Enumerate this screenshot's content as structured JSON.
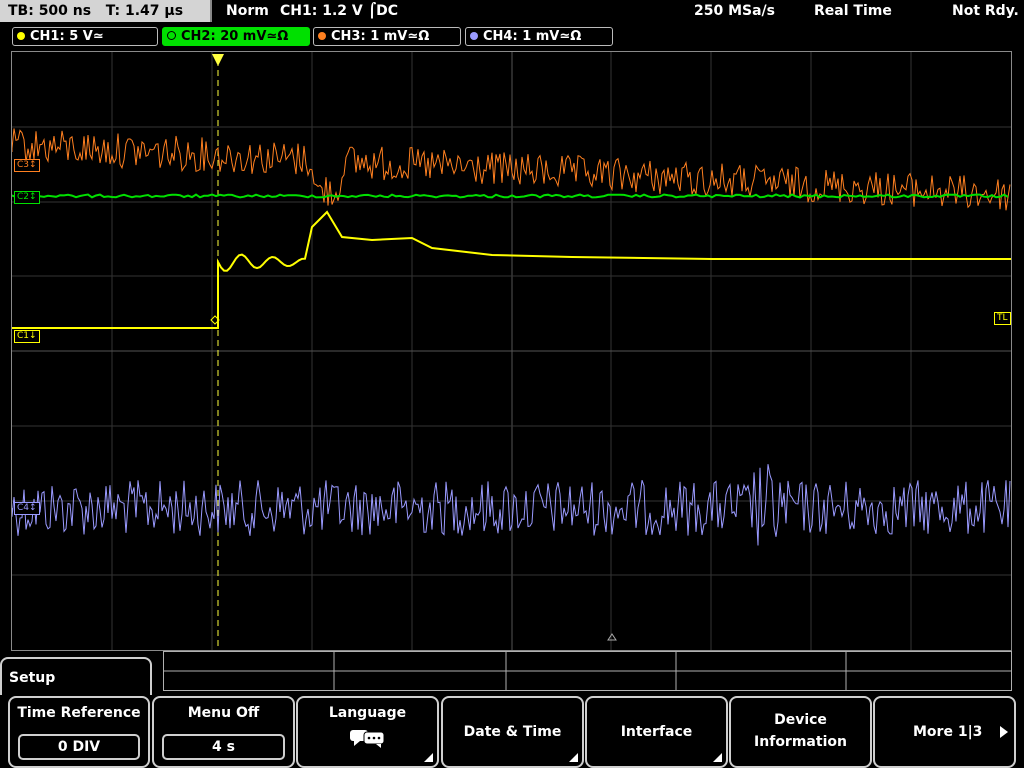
{
  "status": {
    "timebase": "TB: 500 ns",
    "trigger_time": "T: 1.47 µs",
    "mode": "Norm",
    "trigger_setting": "CH1: 1.2 V ⌠DC",
    "sample_rate": "250 MSa/s",
    "acq_mode": "Real Time",
    "readiness": "Not Rdy."
  },
  "channels": [
    {
      "label": "CH1: 5 V≃",
      "color": "#ffff00"
    },
    {
      "label": "CH2: 20 mV≃Ω",
      "color": "#00e000"
    },
    {
      "label": "CH3: 1 mV≃Ω",
      "color": "#ff8020"
    },
    {
      "label": "CH4: 1 mV≃Ω",
      "color": "#9a9aff"
    }
  ],
  "markers": {
    "ch1": "C1↓",
    "ch2": "C2↕",
    "ch3": "C3↕",
    "ch4": "C4↕",
    "trigger_level": "TL",
    "trigger_pos": "T"
  },
  "menu": {
    "title": "Setup",
    "softkeys": [
      {
        "label": "Time Reference",
        "value": "0 DIV"
      },
      {
        "label": "Menu Off",
        "value": "4 s"
      },
      {
        "label": "Language",
        "icon": "speech-bubbles-icon"
      },
      {
        "label": "Date & Time"
      },
      {
        "label": "Interface"
      },
      {
        "label": "Device",
        "label2": "Information"
      },
      {
        "label": "More 1|3",
        "icon": "play-arrow-icon"
      }
    ]
  }
}
